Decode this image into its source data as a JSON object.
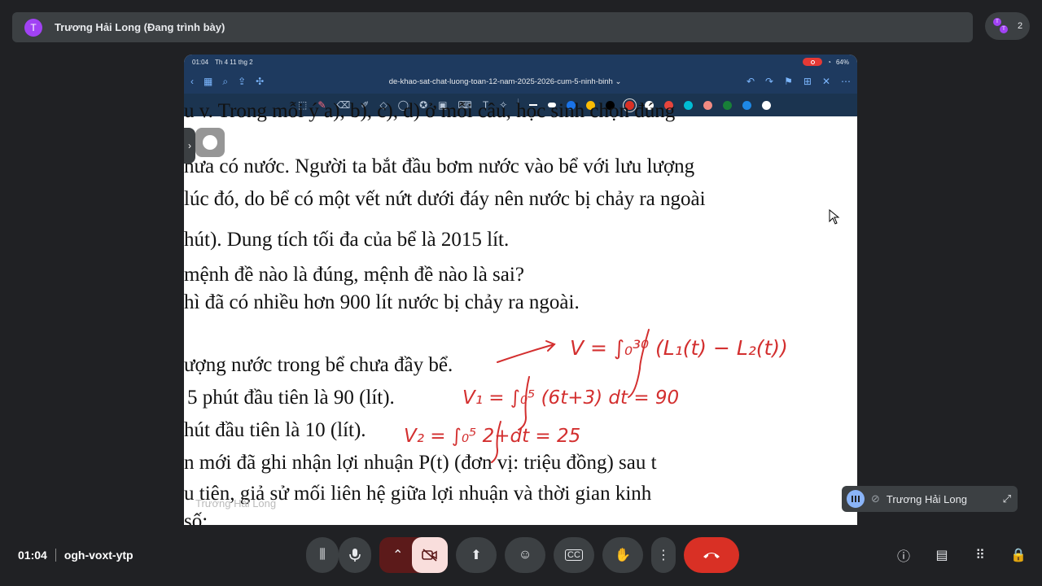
{
  "topbar": {
    "avatar_letter": "T",
    "presenter": "Trương Hải Long (Đang trình bày)"
  },
  "participants": {
    "count": "2",
    "avatar_letter": "T"
  },
  "tablet": {
    "status": {
      "time": "01:04",
      "date": "Th 4 11 thg 2",
      "battery": "64%"
    },
    "doc_title": "de-khao-sat-chat-luong-toan-12-nam-2025-2026-cum-5-ninh-binh ⌄",
    "pen_colors": [
      "#1a73e8",
      "#fbbc04",
      "#000000",
      "#d93025",
      "#ffffff",
      "#e8453c",
      "#00bcd4",
      "#f28b82",
      "#188038",
      "#1e88e5",
      "#ffffff"
    ],
    "selected_color": "#d93025"
  },
  "document": {
    "lines": [
      "u v. Trong mỗi ý a), b), c), d) ở mỗi câu, học sinh chọn đúng",
      "hưa có nước. Người ta bắt đầu bơm nước vào bể với lưu lượng",
      "lúc đó, do bể có một vết nứt dưới đáy nên nước bị chảy ra ngoài",
      "hút). Dung tích tối đa của bể là 2015 lít.",
      "mệnh đề nào là đúng, mệnh đề nào là sai?",
      "hì đã có nhiều hơn 900 lít nước bị chảy ra ngoài.",
      "ượng nước trong bể chưa đầy bể.",
      "5 phút đầu tiên là 90 (lít).",
      "hút đầu tiên là 10 (lít).",
      "n mới đã ghi nhận lợi nhuận  P(t)  (đơn vị: triệu đồng) sau  t",
      "u tiên, giả sử mối liên hệ giữa lợi nhuận và thời gian kinh",
      "số:"
    ],
    "handwriting": {
      "eq1": "V = ∫₀³⁰ (L₁(t) − L₂(t))",
      "eq2": "V₁ = ∫₀⁵ (6t+3) dt = 90",
      "eq3": "V₂ = ∫₀⁵ 2+dt = 25"
    },
    "watermark": "Trương Hải Long"
  },
  "self_tile": {
    "name": "Trương Hải Long"
  },
  "bottom": {
    "time": "01:04",
    "meeting_code": "ogh-voxt-ytp"
  }
}
